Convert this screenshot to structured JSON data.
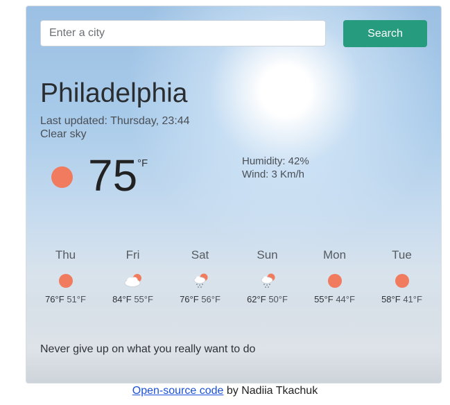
{
  "search": {
    "placeholder": "Enter a city",
    "button_label": "Search"
  },
  "current": {
    "city": "Philadelphia",
    "last_updated": "Last updated: Thursday, 23:44",
    "description": "Clear sky",
    "temperature": "75",
    "unit": "°F",
    "humidity": "Humidity: 42%",
    "wind": "Wind: 3 Km/h",
    "icon": "sun-icon"
  },
  "forecast": [
    {
      "day": "Thu",
      "high": "76°F",
      "low": "51°F",
      "icon": "sun-icon"
    },
    {
      "day": "Fri",
      "high": "84°F",
      "low": "55°F",
      "icon": "partly-cloudy-icon"
    },
    {
      "day": "Sat",
      "high": "76°F",
      "low": "56°F",
      "icon": "rain-sun-icon"
    },
    {
      "day": "Sun",
      "high": "62°F",
      "low": "50°F",
      "icon": "rain-sun-icon"
    },
    {
      "day": "Mon",
      "high": "55°F",
      "low": "44°F",
      "icon": "sun-icon"
    },
    {
      "day": "Tue",
      "high": "58°F",
      "low": "41°F",
      "icon": "sun-icon"
    }
  ],
  "quote": "Never give up on what you really want to do",
  "footer": {
    "link_text": "Open-source code",
    "suffix": "by Nadiia Tkachuk"
  },
  "colors": {
    "accent": "#279b7e",
    "sun": "#f07b5e",
    "link": "#1a4fd6"
  }
}
